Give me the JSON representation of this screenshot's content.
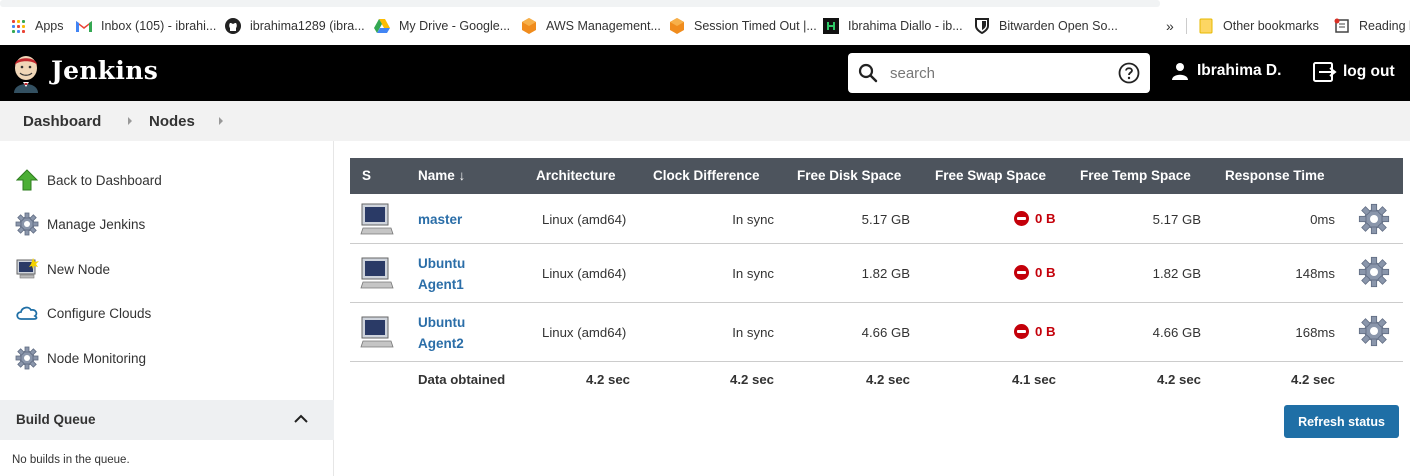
{
  "bookmarks": [
    {
      "label": "Apps",
      "icon": "apps-grid-icon"
    },
    {
      "label": "Inbox (105) - ibrahi...",
      "icon": "gmail-icon"
    },
    {
      "label": "ibrahima1289 (ibra...",
      "icon": "github-icon"
    },
    {
      "label": "My Drive - Google...",
      "icon": "google-drive-icon"
    },
    {
      "label": "AWS Management...",
      "icon": "aws-icon"
    },
    {
      "label": "Session Timed Out |...",
      "icon": "aws-icon"
    },
    {
      "label": "Ibrahima Diallo - ib...",
      "icon": "hackerrank-icon"
    },
    {
      "label": "Bitwarden Open So...",
      "icon": "bitwarden-shield-icon"
    }
  ],
  "bookmarks_overflow": "»",
  "other_bookmarks": "Other bookmarks",
  "reading_list": "Reading li",
  "header": {
    "brand": "Jenkins",
    "search_placeholder": "search",
    "user": "Ibrahima D.",
    "logout": "log out"
  },
  "breadcrumb": [
    "Dashboard",
    "Nodes"
  ],
  "sidebar": {
    "items": [
      {
        "label": "Back to Dashboard",
        "icon": "up-arrow-icon"
      },
      {
        "label": "Manage Jenkins",
        "icon": "gear-icon"
      },
      {
        "label": "New Node",
        "icon": "computer-icon"
      },
      {
        "label": "Configure Clouds",
        "icon": "cloud-icon"
      },
      {
        "label": "Node Monitoring",
        "icon": "gear-icon"
      }
    ],
    "build_queue_title": "Build Queue",
    "build_queue_empty": "No builds in the queue."
  },
  "table": {
    "headers": [
      "S",
      "Name ↓",
      "Architecture",
      "Clock Difference",
      "Free Disk Space",
      "Free Swap Space",
      "Free Temp Space",
      "Response Time"
    ],
    "rows": [
      {
        "name_line1": "master",
        "name_line2": "",
        "arch": "Linux (amd64)",
        "clock": "In sync",
        "disk": "5.17 GB",
        "swap": "0 B",
        "temp": "5.17 GB",
        "response": "0ms"
      },
      {
        "name_line1": "Ubuntu",
        "name_line2": "Agent1",
        "arch": "Linux (amd64)",
        "clock": "In sync",
        "disk": "1.82 GB",
        "swap": "0 B",
        "temp": "1.82 GB",
        "response": "148ms"
      },
      {
        "name_line1": "Ubuntu",
        "name_line2": "Agent2",
        "arch": "Linux (amd64)",
        "clock": "In sync",
        "disk": "4.66 GB",
        "swap": "0 B",
        "temp": "4.66 GB",
        "response": "168ms"
      }
    ],
    "footer": {
      "label": "Data obtained",
      "arch": "4.2 sec",
      "clock": "4.2 sec",
      "disk": "4.2 sec",
      "swap": "4.1 sec",
      "temp": "4.2 sec",
      "response": "4.2 sec"
    }
  },
  "refresh_button": "Refresh status",
  "colors": {
    "header_bg": "#000000",
    "table_header_bg": "#4d545d",
    "link": "#2b6ea8",
    "error": "#c4000a",
    "button": "#1f6fa6"
  }
}
